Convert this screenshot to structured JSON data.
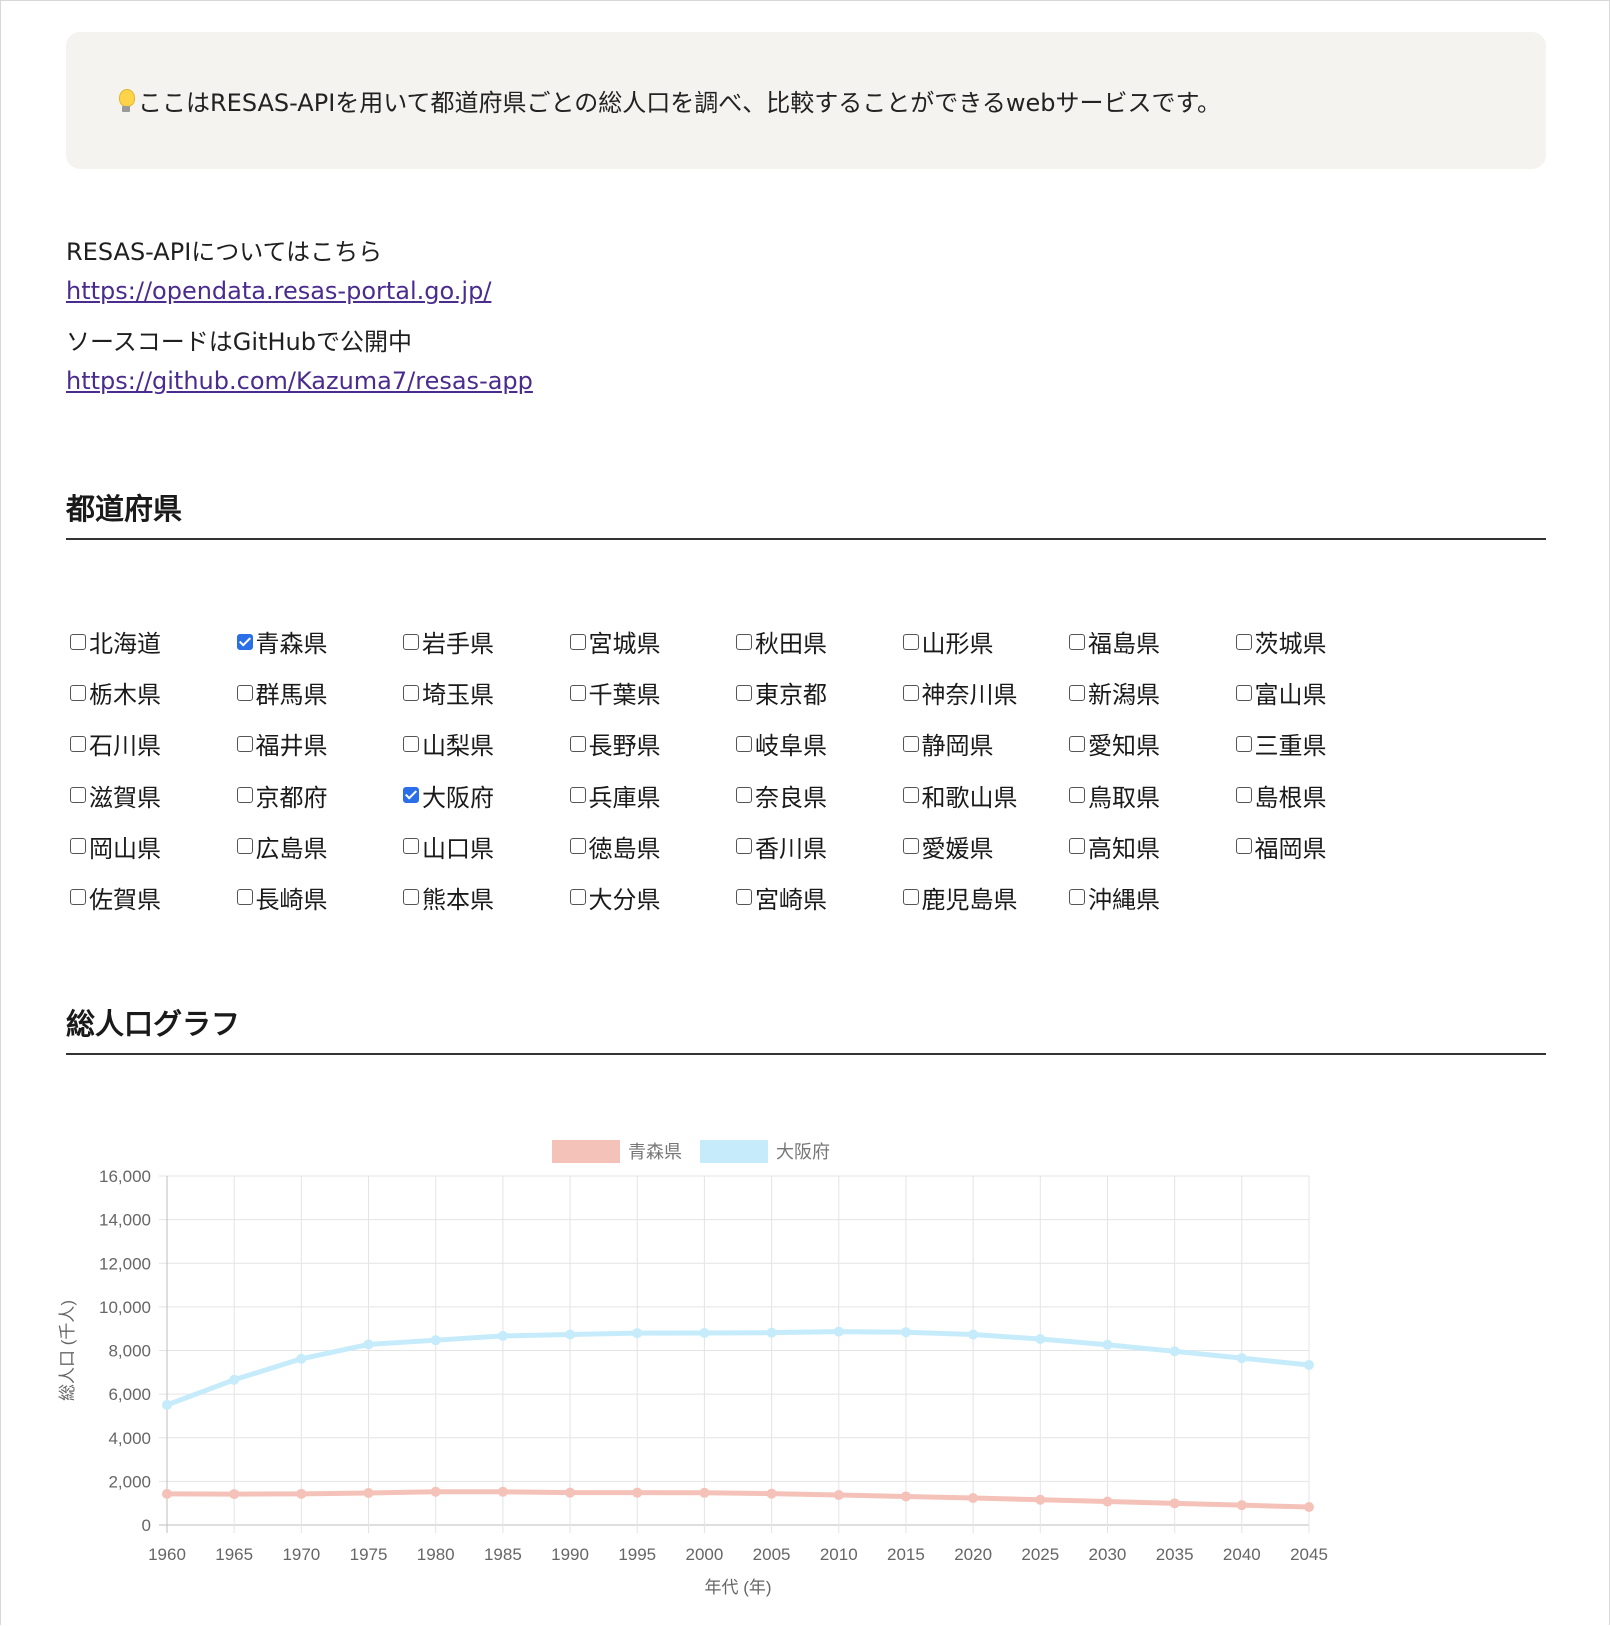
{
  "intro": {
    "text": "ここはRESAS-APIを用いて都道府県ごとの総人口を調べ、比較することができるwebサービスです。"
  },
  "links": {
    "resas_label": "RESAS-APIについてはこちら",
    "resas_url": "https://opendata.resas-portal.go.jp/",
    "github_label": "ソースコードはGitHubで公開中",
    "github_url": "https://github.com/Kazuma7/resas-app"
  },
  "sections": {
    "prefectures_title": "都道府県",
    "graph_title": "総人口グラフ"
  },
  "prefectures": [
    {
      "name": "北海道",
      "checked": false
    },
    {
      "name": "青森県",
      "checked": true
    },
    {
      "name": "岩手県",
      "checked": false
    },
    {
      "name": "宮城県",
      "checked": false
    },
    {
      "name": "秋田県",
      "checked": false
    },
    {
      "name": "山形県",
      "checked": false
    },
    {
      "name": "福島県",
      "checked": false
    },
    {
      "name": "茨城県",
      "checked": false
    },
    {
      "name": "栃木県",
      "checked": false
    },
    {
      "name": "群馬県",
      "checked": false
    },
    {
      "name": "埼玉県",
      "checked": false
    },
    {
      "name": "千葉県",
      "checked": false
    },
    {
      "name": "東京都",
      "checked": false
    },
    {
      "name": "神奈川県",
      "checked": false
    },
    {
      "name": "新潟県",
      "checked": false
    },
    {
      "name": "富山県",
      "checked": false
    },
    {
      "name": "石川県",
      "checked": false
    },
    {
      "name": "福井県",
      "checked": false
    },
    {
      "name": "山梨県",
      "checked": false
    },
    {
      "name": "長野県",
      "checked": false
    },
    {
      "name": "岐阜県",
      "checked": false
    },
    {
      "name": "静岡県",
      "checked": false
    },
    {
      "name": "愛知県",
      "checked": false
    },
    {
      "name": "三重県",
      "checked": false
    },
    {
      "name": "滋賀県",
      "checked": false
    },
    {
      "name": "京都府",
      "checked": false
    },
    {
      "name": "大阪府",
      "checked": true
    },
    {
      "name": "兵庫県",
      "checked": false
    },
    {
      "name": "奈良県",
      "checked": false
    },
    {
      "name": "和歌山県",
      "checked": false
    },
    {
      "name": "鳥取県",
      "checked": false
    },
    {
      "name": "島根県",
      "checked": false
    },
    {
      "name": "岡山県",
      "checked": false
    },
    {
      "name": "広島県",
      "checked": false
    },
    {
      "name": "山口県",
      "checked": false
    },
    {
      "name": "徳島県",
      "checked": false
    },
    {
      "name": "香川県",
      "checked": false
    },
    {
      "name": "愛媛県",
      "checked": false
    },
    {
      "name": "高知県",
      "checked": false
    },
    {
      "name": "福岡県",
      "checked": false
    },
    {
      "name": "佐賀県",
      "checked": false
    },
    {
      "name": "長崎県",
      "checked": false
    },
    {
      "name": "熊本県",
      "checked": false
    },
    {
      "name": "大分県",
      "checked": false
    },
    {
      "name": "宮崎県",
      "checked": false
    },
    {
      "name": "鹿児島県",
      "checked": false
    },
    {
      "name": "沖縄県",
      "checked": false
    }
  ],
  "chart_data": {
    "type": "line",
    "xlabel": "年代 (年)",
    "ylabel": "総人口 (千人)",
    "ylim": [
      0,
      16000
    ],
    "y_ticks": [
      "0",
      "2,000",
      "4,000",
      "6,000",
      "8,000",
      "10,000",
      "12,000",
      "14,000",
      "16,000"
    ],
    "grid": true,
    "legend_position": "top",
    "x": [
      1960,
      1965,
      1970,
      1975,
      1980,
      1985,
      1990,
      1995,
      2000,
      2005,
      2010,
      2015,
      2020,
      2025,
      2030,
      2035,
      2040,
      2045
    ],
    "series": [
      {
        "name": "青森県",
        "color": "#f4c2b8",
        "values": [
          1427,
          1417,
          1428,
          1469,
          1524,
          1524,
          1483,
          1482,
          1476,
          1437,
          1373,
          1308,
          1238,
          1157,
          1076,
          994,
          909,
          824
        ]
      },
      {
        "name": "大阪府",
        "color": "#c6ecfb",
        "values": [
          5505,
          6657,
          7620,
          8279,
          8473,
          8668,
          8735,
          8797,
          8805,
          8817,
          8865,
          8839,
          8732,
          8526,
          8262,
          7963,
          7649,
          7335
        ]
      }
    ]
  }
}
